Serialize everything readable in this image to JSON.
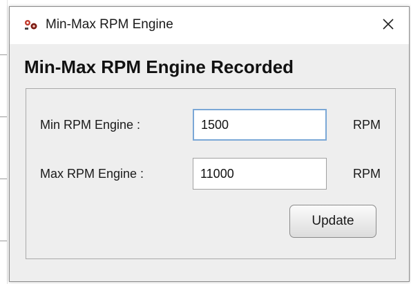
{
  "window": {
    "title": "Min-Max RPM Engine",
    "icon": "app-logo-icon",
    "close_icon": "close-icon"
  },
  "heading": "Min-Max RPM Engine Recorded",
  "form": {
    "min": {
      "label": "Min RPM  Engine :",
      "value": "1500",
      "unit": "RPM"
    },
    "max": {
      "label": "Max RPM Engine :",
      "value": "11000",
      "unit": "RPM"
    }
  },
  "update_label": "Update",
  "colors": {
    "dialog_bg": "#eeeeee",
    "titlebar_bg": "#ffffff",
    "focus_border": "#7aa7d6"
  }
}
